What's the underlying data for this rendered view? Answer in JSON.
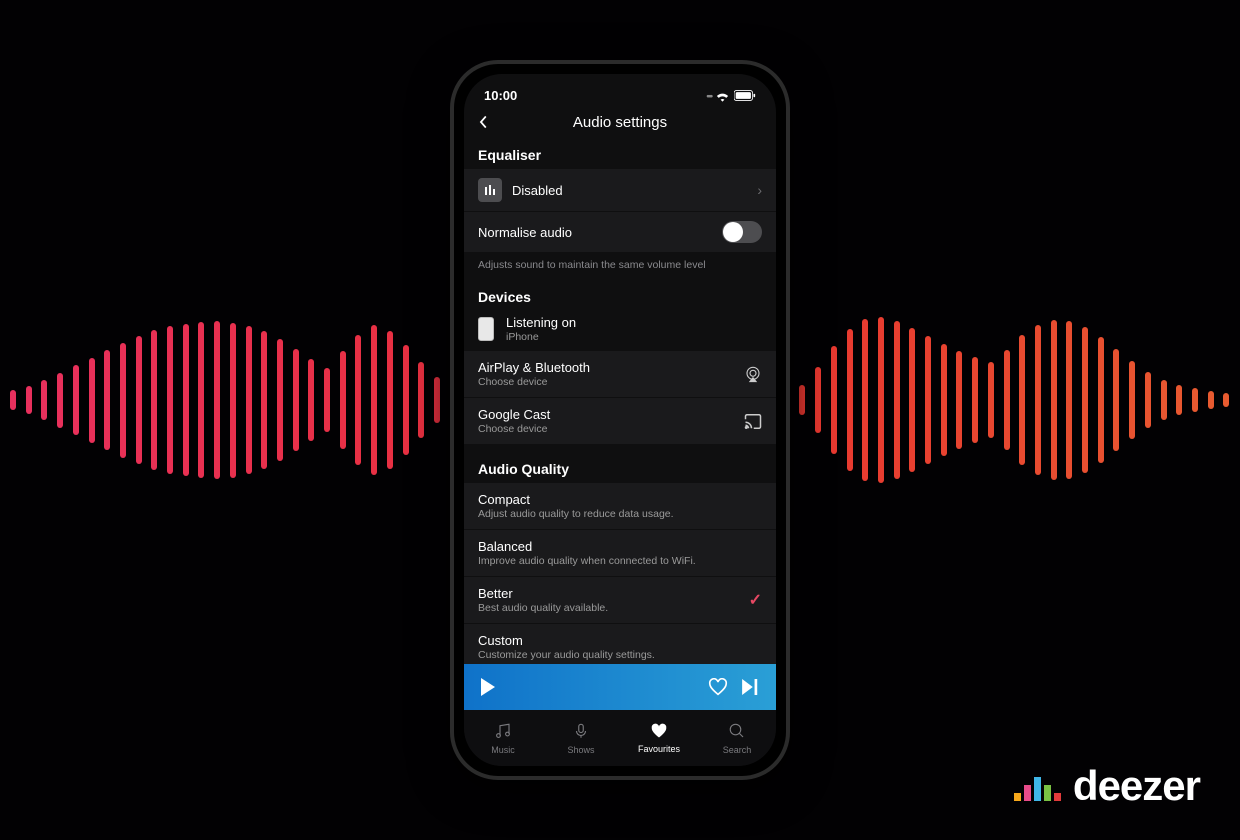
{
  "status": {
    "time": "10:00"
  },
  "nav": {
    "title": "Audio settings"
  },
  "sections": {
    "equaliser": {
      "heading": "Equaliser",
      "status": "Disabled",
      "normalise_label": "Normalise audio",
      "normalise_help": "Adjusts sound to maintain the same volume level"
    },
    "devices": {
      "heading": "Devices",
      "listening_label": "Listening on",
      "listening_device": "iPhone",
      "airplay_label": "AirPlay & Bluetooth",
      "airplay_sub": "Choose device",
      "cast_label": "Google Cast",
      "cast_sub": "Choose device"
    },
    "quality": {
      "heading": "Audio Quality",
      "options": [
        {
          "label": "Compact",
          "sub": "Adjust audio quality to reduce data usage.",
          "selected": false
        },
        {
          "label": "Balanced",
          "sub": "Improve audio quality when connected to WiFi.",
          "selected": false
        },
        {
          "label": "Better",
          "sub": "Best audio quality available.",
          "selected": true
        },
        {
          "label": "Custom",
          "sub": "Customize your audio quality settings.",
          "selected": false
        }
      ]
    }
  },
  "tabs": [
    {
      "label": "Music",
      "active": false
    },
    {
      "label": "Shows",
      "active": false
    },
    {
      "label": "Favourites",
      "active": true
    },
    {
      "label": "Search",
      "active": false
    }
  ],
  "brand": {
    "name": "deezer"
  },
  "colors": {
    "accent": "#e74863",
    "player_start": "#0f72c9",
    "player_end": "#2a9fd6"
  }
}
